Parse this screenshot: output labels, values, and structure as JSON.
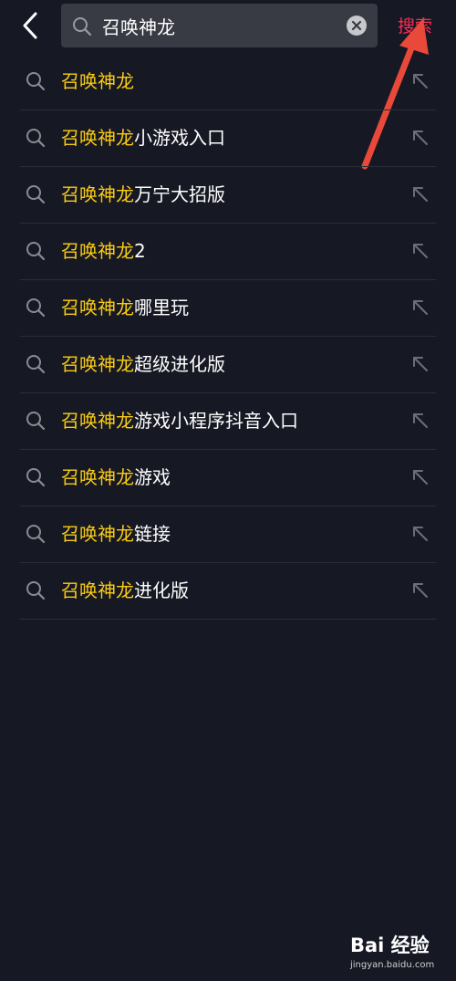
{
  "header": {
    "query_value": "召唤神龙",
    "submit_label": "搜索",
    "icons": {
      "back": "chevron-left-icon",
      "search": "search-icon",
      "clear": "clear-icon"
    }
  },
  "suggestions": [
    {
      "highlight": "召唤神龙",
      "rest": ""
    },
    {
      "highlight": "召唤神龙",
      "rest": "小游戏入口"
    },
    {
      "highlight": "召唤神龙",
      "rest": "万宁大招版"
    },
    {
      "highlight": "召唤神龙",
      "rest": "2"
    },
    {
      "highlight": "召唤神龙",
      "rest": "哪里玩"
    },
    {
      "highlight": "召唤神龙",
      "rest": "超级进化版"
    },
    {
      "highlight": "召唤神龙",
      "rest": "游戏小程序抖音入口"
    },
    {
      "highlight": "召唤神龙",
      "rest": "游戏"
    },
    {
      "highlight": "召唤神龙",
      "rest": "链接"
    },
    {
      "highlight": "召唤神龙",
      "rest": "进化版"
    }
  ],
  "watermark": {
    "brand": "Bai 经验",
    "url": "jingyan.baidu.com"
  },
  "colors": {
    "background": "#161823",
    "highlight": "#facc15",
    "accent": "#fe2c55",
    "annotation_arrow": "#e8493a"
  }
}
